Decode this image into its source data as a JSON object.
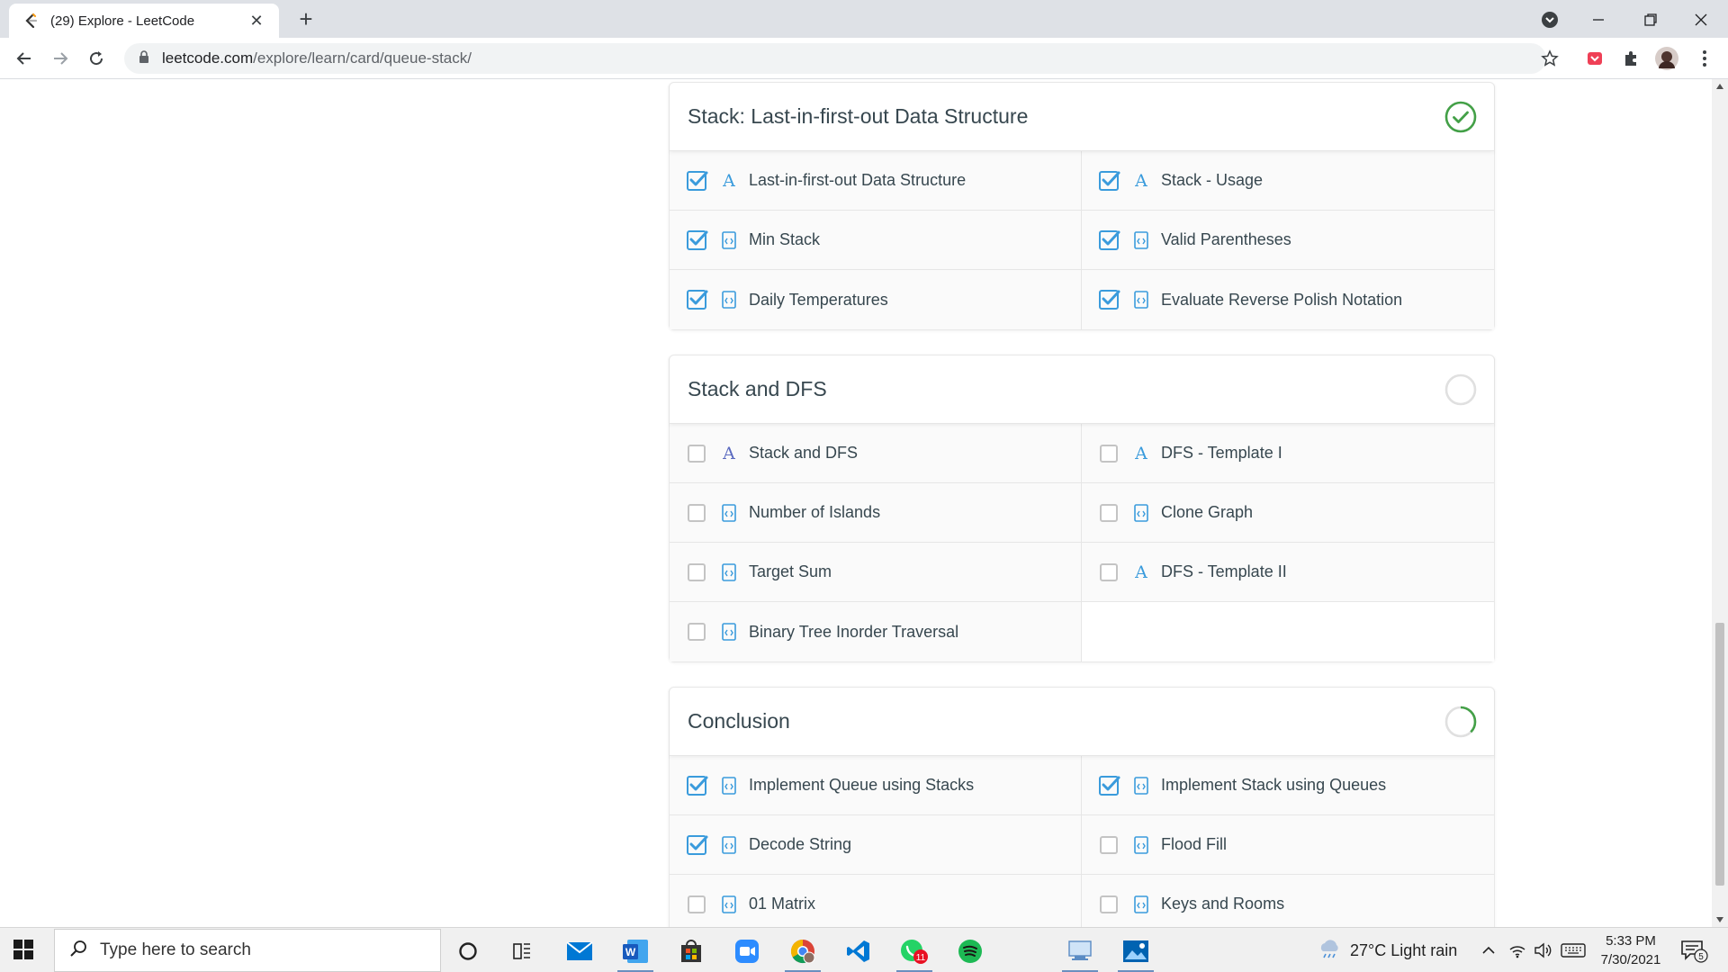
{
  "browser": {
    "tab_title": "(29) Explore - LeetCode",
    "url_host": "leetcode.com",
    "url_path": "/explore/learn/card/queue-stack/"
  },
  "chapters": [
    {
      "title": "Stack: Last-in-first-out Data Structure",
      "status": "complete",
      "items": [
        {
          "label": "Last-in-first-out Data Structure",
          "type": "article",
          "checked": true
        },
        {
          "label": "Stack - Usage",
          "type": "article",
          "checked": true
        },
        {
          "label": "Min Stack",
          "type": "problem",
          "checked": true
        },
        {
          "label": "Valid Parentheses",
          "type": "problem",
          "checked": true
        },
        {
          "label": "Daily Temperatures",
          "type": "problem",
          "checked": true
        },
        {
          "label": "Evaluate Reverse Polish Notation",
          "type": "problem",
          "checked": true
        }
      ]
    },
    {
      "title": "Stack and DFS",
      "status": "not-started",
      "items": [
        {
          "label": "Stack and DFS",
          "type": "article",
          "checked": false
        },
        {
          "label": "DFS - Template I",
          "type": "article",
          "checked": false
        },
        {
          "label": "Number of Islands",
          "type": "problem",
          "checked": false
        },
        {
          "label": "Clone Graph",
          "type": "problem",
          "checked": false
        },
        {
          "label": "Target Sum",
          "type": "problem",
          "checked": false
        },
        {
          "label": "DFS - Template II",
          "type": "article",
          "checked": false
        },
        {
          "label": "Binary Tree Inorder Traversal",
          "type": "problem",
          "checked": false
        }
      ]
    },
    {
      "title": "Conclusion",
      "status": "in-progress",
      "progress": 0.375,
      "items": [
        {
          "label": "Implement Queue using Stacks",
          "type": "problem",
          "checked": true
        },
        {
          "label": "Implement Stack using Queues",
          "type": "problem",
          "checked": true
        },
        {
          "label": "Decode String",
          "type": "problem",
          "checked": true
        },
        {
          "label": "Flood Fill",
          "type": "problem",
          "checked": false
        },
        {
          "label": "01 Matrix",
          "type": "problem",
          "checked": false
        },
        {
          "label": "Keys and Rooms",
          "type": "problem",
          "checked": false
        }
      ]
    }
  ],
  "taskbar": {
    "search_placeholder": "Type here to search",
    "weather": "27°C  Light rain",
    "time": "5:33 PM",
    "date": "7/30/2021",
    "whatsapp_badge": "11",
    "notification_badge": "5"
  },
  "colors": {
    "check_blue": "#3a9bdc",
    "complete_green": "#43a047",
    "text": "#37474f"
  }
}
